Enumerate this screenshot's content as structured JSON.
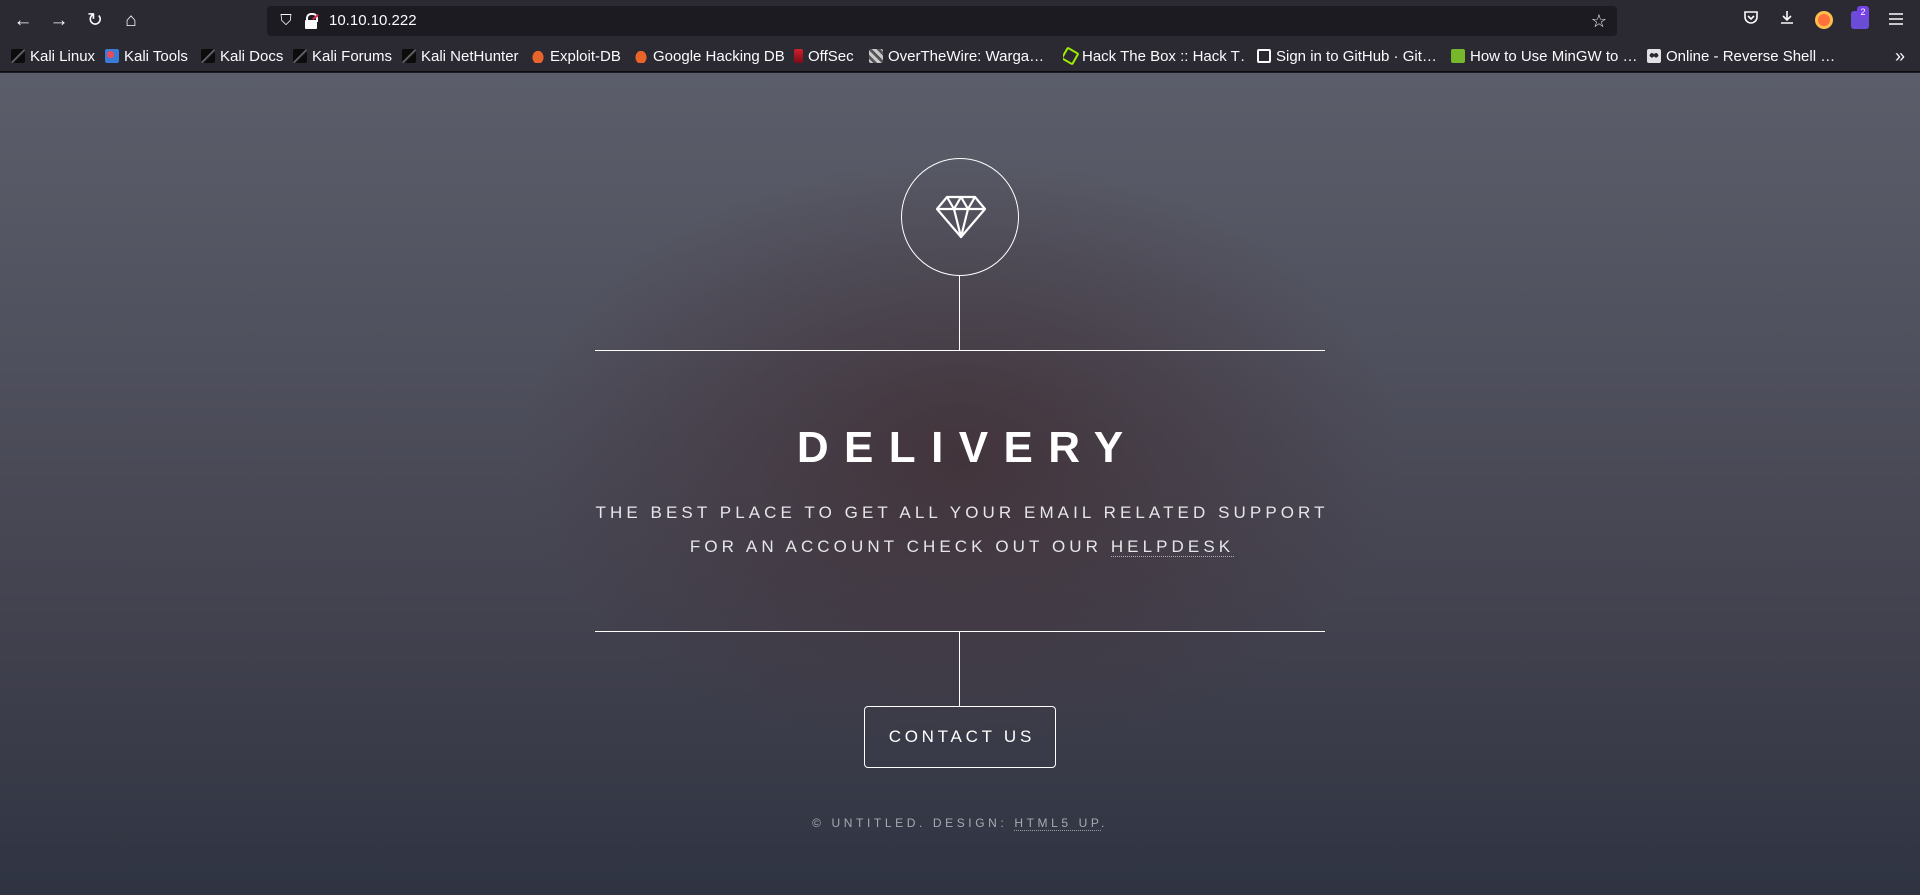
{
  "browser": {
    "nav": {
      "back_icon": "←",
      "forward_icon": "→",
      "reload_icon": "↻",
      "home_icon": "⌂"
    },
    "url": "10.10.10.222",
    "extension_badge": "2",
    "overflow_icon": "»",
    "bookmarks": [
      {
        "label": "Kali Linux",
        "icon": "kali-dragon-icon"
      },
      {
        "label": "Kali Tools",
        "icon": "kali-tools-icon"
      },
      {
        "label": "Kali Docs",
        "icon": "kali-dragon-icon"
      },
      {
        "label": "Kali Forums",
        "icon": "kali-dragon-icon"
      },
      {
        "label": "Kali NetHunter",
        "icon": "kali-dragon-icon"
      },
      {
        "label": "Exploit-DB",
        "icon": "exploit-db-icon"
      },
      {
        "label": "Google Hacking DB",
        "icon": "exploit-db-icon"
      },
      {
        "label": "OffSec",
        "icon": "offsec-icon"
      },
      {
        "label": "OverTheWire: Warga…",
        "icon": "overthewire-icon"
      },
      {
        "label": "Hack The Box :: Hack T…",
        "icon": "hackthebox-icon"
      },
      {
        "label": "Sign in to GitHub · Git…",
        "icon": "github-icon"
      },
      {
        "label": "How to Use MinGW to …",
        "icon": "mingw-icon"
      },
      {
        "label": "Online - Reverse Shell …",
        "icon": "skull-icon"
      }
    ]
  },
  "page": {
    "title": "DELIVERY",
    "tagline_1": "THE BEST PLACE TO GET ALL YOUR EMAIL RELATED SUPPORT",
    "tagline_2_prefix": "FOR AN ACCOUNT CHECK OUT OUR ",
    "helpdesk_link": "HELPDESK",
    "contact_button": "CONTACT US",
    "footer_prefix": "© UNTITLED. DESIGN: ",
    "footer_link": "HTML5 UP",
    "footer_suffix": "."
  }
}
